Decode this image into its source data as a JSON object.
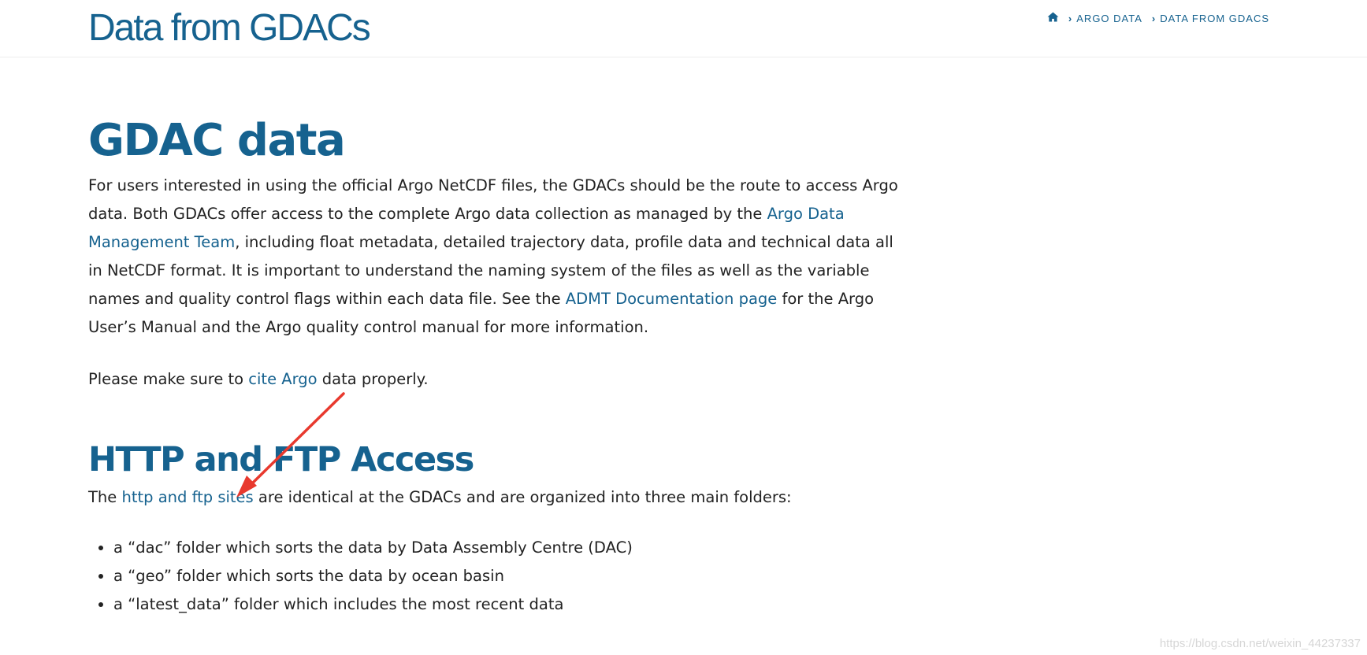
{
  "header": {
    "title": "Data from GDACs",
    "breadcrumb": {
      "home_icon": "home-icon",
      "items": [
        "ARGO DATA",
        "DATA FROM GDACS"
      ]
    }
  },
  "gdac_section": {
    "heading": "GDAC data",
    "intro": {
      "part1": "For users interested in using the official Argo NetCDF files, the GDACs should be the route to access Argo data. Both GDACs offer access to the complete Argo data collection as managed by the ",
      "link1": "Argo Data Management Team",
      "part2": ", including float metadata, detailed trajectory data, profile data and technical data all in NetCDF format.  It is important to understand the naming system of the files as well as the variable names and quality control flags within each data file. See the ",
      "link2": "ADMT Documentation page",
      "part3": " for the Argo User’s Manual and the Argo quality control manual for more information."
    },
    "cite": {
      "part1": "Please make sure to ",
      "link": "cite Argo",
      "part2": " data properly."
    }
  },
  "http_section": {
    "heading": "HTTP and FTP Access",
    "intro": {
      "part1": "The ",
      "link": "http and ftp sites",
      "part2": " are identical at the GDACs and are organized into three main folders:"
    },
    "folders": [
      "a “dac” folder which sorts the data by Data Assembly Centre (DAC)",
      "a “geo” folder which sorts the data by ocean basin",
      "a “latest_data” folder which includes the most recent data"
    ]
  },
  "watermark": "https://blog.csdn.net/weixin_44237337",
  "colors": {
    "brand": "#16628f",
    "annotation": "#e8392e",
    "text": "#222222"
  }
}
